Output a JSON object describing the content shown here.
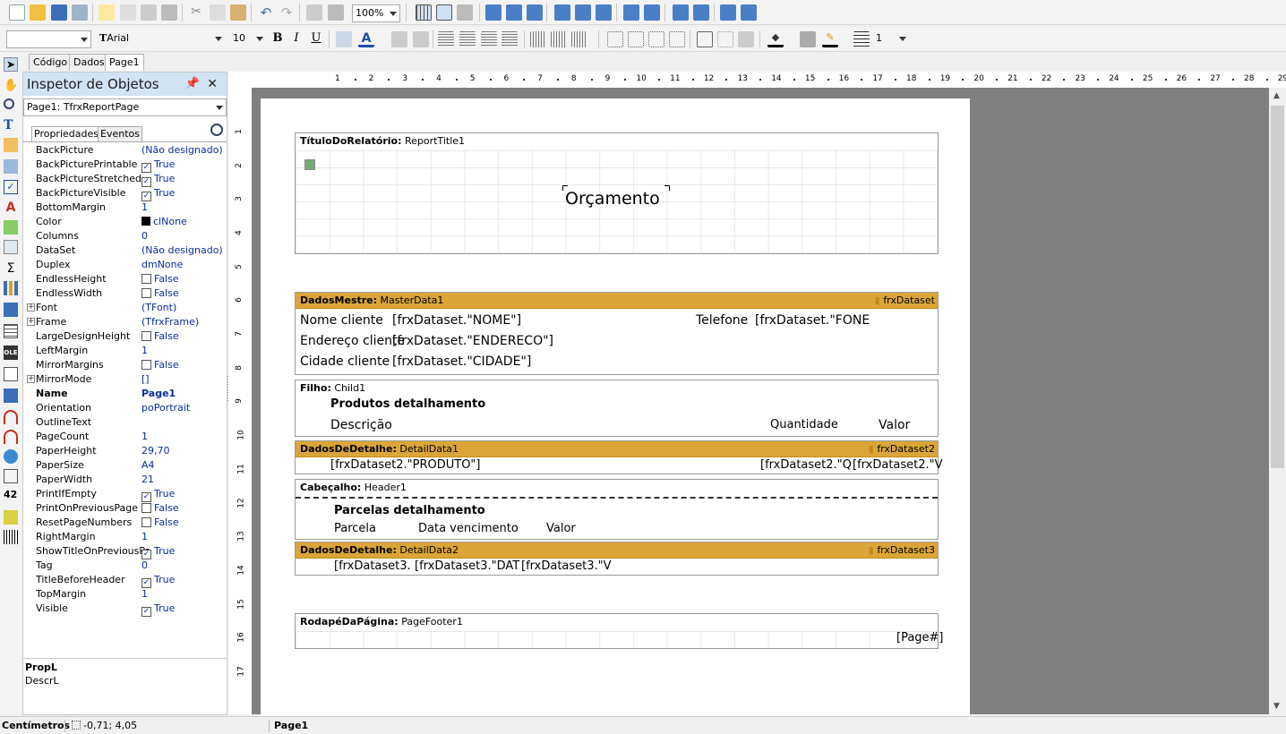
{
  "toolbar": {
    "zoom": "100%",
    "font_name": "Arial",
    "font_size": "10",
    "frame_width": "1",
    "bold": "B",
    "italic": "I",
    "underline": "U"
  },
  "designer_tabs": [
    "Código",
    "Dados",
    "Page1"
  ],
  "inspector": {
    "title": "Inspetor de Objetos",
    "object_selector": "Page1: TfrxReportPage",
    "tabs": [
      "Propriedades",
      "Eventos"
    ],
    "properties": [
      {
        "name": "BackPicture",
        "value": "(Não designado)"
      },
      {
        "name": "BackPicturePrintable",
        "value": "True",
        "check": "on"
      },
      {
        "name": "BackPictureStretched",
        "value": "True",
        "check": "on"
      },
      {
        "name": "BackPictureVisible",
        "value": "True",
        "check": "on"
      },
      {
        "name": "BottomMargin",
        "value": "1"
      },
      {
        "name": "Color",
        "value": "clNone",
        "swatch": true
      },
      {
        "name": "Columns",
        "value": "0"
      },
      {
        "name": "DataSet",
        "value": "(Não designado)"
      },
      {
        "name": "Duplex",
        "value": "dmNone"
      },
      {
        "name": "EndlessHeight",
        "value": "False",
        "check": "off"
      },
      {
        "name": "EndlessWidth",
        "value": "False",
        "check": "off"
      },
      {
        "name": "Font",
        "value": "(TFont)",
        "expand": true
      },
      {
        "name": "Frame",
        "value": "(TfrxFrame)",
        "expand": true
      },
      {
        "name": "LargeDesignHeight",
        "value": "False",
        "check": "off"
      },
      {
        "name": "LeftMargin",
        "value": "1"
      },
      {
        "name": "MirrorMargins",
        "value": "False",
        "check": "off"
      },
      {
        "name": "MirrorMode",
        "value": "[]",
        "expand": true
      },
      {
        "name": "Name",
        "value": "Page1",
        "bold": true
      },
      {
        "name": "Orientation",
        "value": "poPortrait"
      },
      {
        "name": "OutlineText",
        "value": ""
      },
      {
        "name": "PageCount",
        "value": "1"
      },
      {
        "name": "PaperHeight",
        "value": "29,70"
      },
      {
        "name": "PaperSize",
        "value": "A4"
      },
      {
        "name": "PaperWidth",
        "value": "21"
      },
      {
        "name": "PrintIfEmpty",
        "value": "True",
        "check": "on"
      },
      {
        "name": "PrintOnPreviousPage",
        "value": "False",
        "check": "off"
      },
      {
        "name": "ResetPageNumbers",
        "value": "False",
        "check": "off"
      },
      {
        "name": "RightMargin",
        "value": "1"
      },
      {
        "name": "ShowTitleOnPreviousPage",
        "value": "True",
        "check": "on"
      },
      {
        "name": "Tag",
        "value": "0"
      },
      {
        "name": "TitleBeforeHeader",
        "value": "True",
        "check": "on"
      },
      {
        "name": "TopMargin",
        "value": "1"
      },
      {
        "name": "Visible",
        "value": "True",
        "check": "on"
      }
    ],
    "description_title": "PropL",
    "description_text": "DescrL"
  },
  "ruler": {
    "top": [
      "1",
      "2",
      "3",
      "4",
      "5",
      "6",
      "7",
      "8",
      "9",
      "10",
      "11",
      "12",
      "13",
      "14",
      "15",
      "16",
      "17",
      "18",
      "19",
      "20",
      "21",
      "22",
      "23",
      "24",
      "25",
      "26",
      "27",
      "28",
      "29"
    ],
    "left": [
      "1",
      "2",
      "3",
      "4",
      "5",
      "6",
      "7",
      "8",
      "9",
      "10",
      "11",
      "12",
      "13",
      "14",
      "15",
      "16",
      "17"
    ]
  },
  "report": {
    "title_band": {
      "type": "TítuloDoRelatório:",
      "name": "ReportTitle1",
      "heading": "Orçamento"
    },
    "master_band": {
      "type": "DadosMestre:",
      "name": "MasterData1",
      "dataset": "frxDataset",
      "f_nome_label": "Nome cliente",
      "f_nome": "[frxDataset.\"NOME\"]",
      "f_tel_label": "Telefone",
      "f_tel": "[frxDataset.\"FONE",
      "f_end_label": "Endereço cliente",
      "f_end": "[frxDataset.\"ENDERECO\"]",
      "f_cid_label": "Cidade cliente",
      "f_cid": "[frxDataset.\"CIDADE\"]"
    },
    "child_band": {
      "type": "Filho:",
      "name": "Child1",
      "heading": "Produtos detalhamento",
      "col1": "Descrição",
      "col2": "Quantidade",
      "col3": "Valor"
    },
    "detail1_band": {
      "type": "DadosDeDetalhe:",
      "name": "DetailData1",
      "dataset": "frxDataset2",
      "f1": "[frxDataset2.\"PRODUTO\"]",
      "f2": "[frxDataset2.\"Q",
      "f3": "[frxDataset2.\"V"
    },
    "header_band": {
      "type": "Cabeçalho:",
      "name": "Header1",
      "heading": "Parcelas detalhamento",
      "col1": "Parcela",
      "col2": "Data vencimento",
      "col3": "Valor"
    },
    "detail2_band": {
      "type": "DadosDeDetalhe:",
      "name": "DetailData2",
      "dataset": "frxDataset3",
      "f1": "[frxDataset3.",
      "f2": "[frxDataset3.\"DAT",
      "f3": "[frxDataset3.\"V"
    },
    "footer_band": {
      "type": "RodapéDaPágina:",
      "name": "PageFooter1",
      "page_num": "[Page#]"
    }
  },
  "status": {
    "units": "Centímetros",
    "coords": "-0,71; 4,05",
    "page": "Page1"
  },
  "colors": {
    "band_gold": "#dba637",
    "inspector_title": "#cfe3f5",
    "workspace": "#808080"
  }
}
